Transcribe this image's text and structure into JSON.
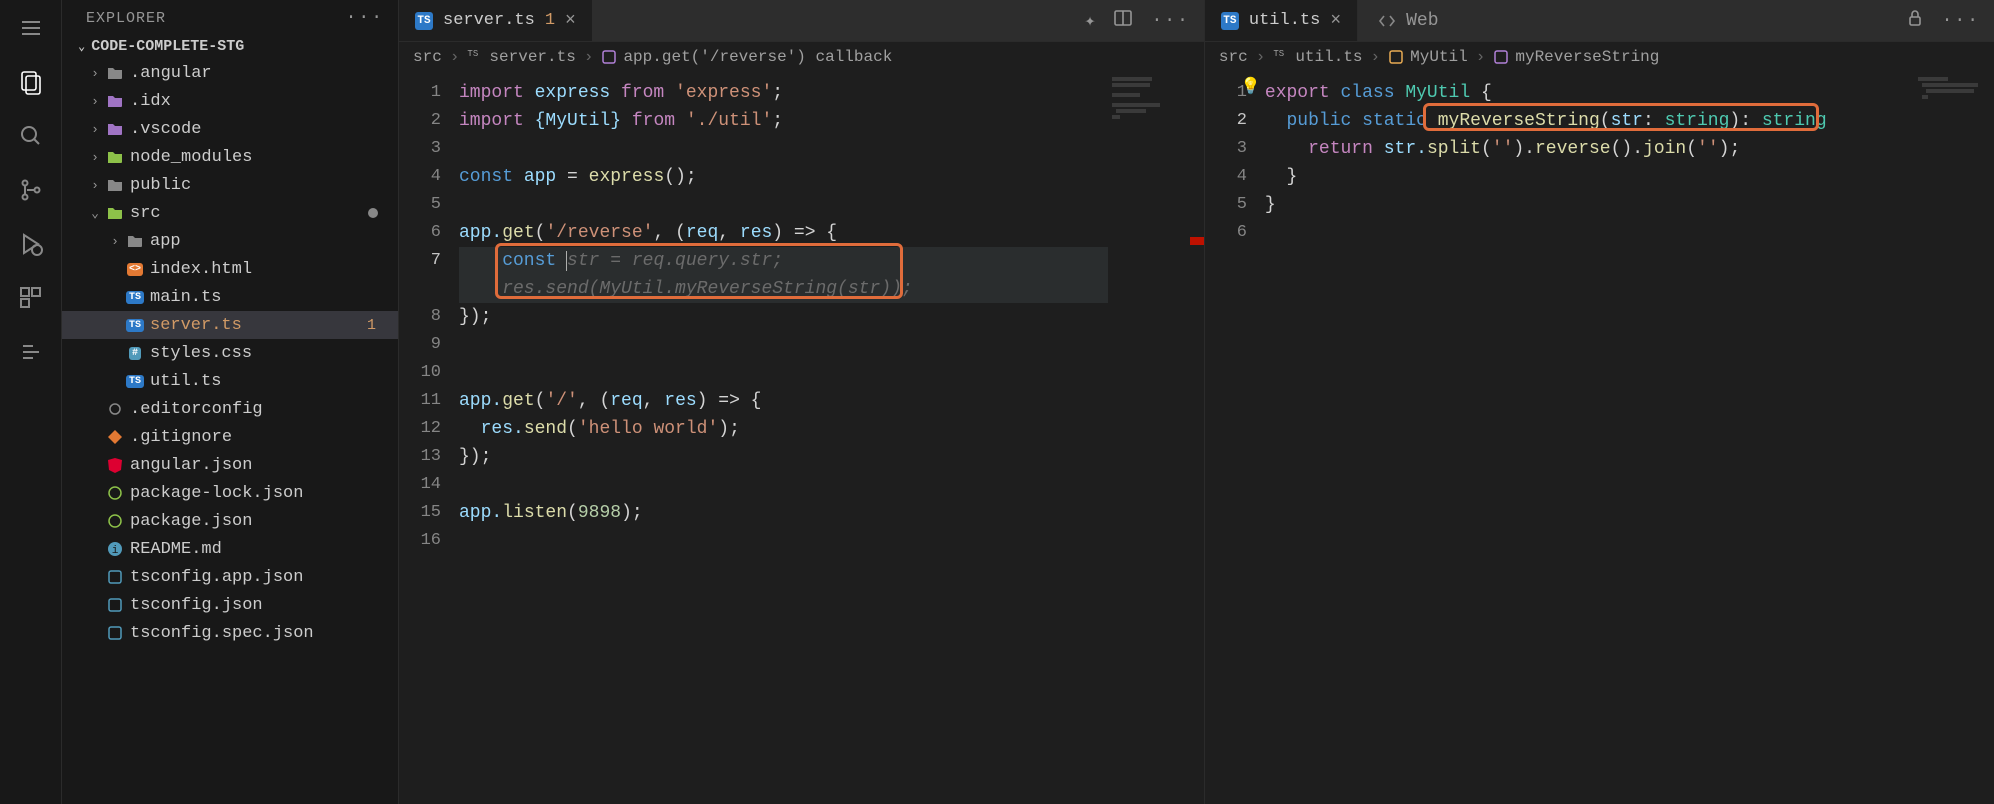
{
  "explorer": {
    "title": "EXPLORER",
    "rootFolder": "CODE-COMPLETE-STG",
    "tree": [
      {
        "label": ".angular",
        "depth": 0,
        "expandable": true,
        "open": false,
        "iconColor": "#888"
      },
      {
        "label": ".idx",
        "depth": 0,
        "expandable": true,
        "open": false,
        "iconColor": "#a074c4"
      },
      {
        "label": ".vscode",
        "depth": 0,
        "expandable": true,
        "open": false,
        "iconColor": "#a074c4"
      },
      {
        "label": "node_modules",
        "depth": 0,
        "expandable": true,
        "open": false,
        "iconColor": "#8dc149"
      },
      {
        "label": "public",
        "depth": 0,
        "expandable": true,
        "open": false,
        "iconColor": "#888"
      },
      {
        "label": "src",
        "depth": 0,
        "expandable": true,
        "open": true,
        "iconColor": "#8dc149",
        "dot": true
      },
      {
        "label": "app",
        "depth": 1,
        "expandable": true,
        "open": false,
        "iconColor": "#888"
      },
      {
        "label": "index.html",
        "depth": 1,
        "expandable": false,
        "icon": "html",
        "iconColor": "#e37933"
      },
      {
        "label": "main.ts",
        "depth": 1,
        "expandable": false,
        "icon": "ts",
        "iconColor": "#519aba"
      },
      {
        "label": "server.ts",
        "depth": 1,
        "expandable": false,
        "icon": "ts",
        "iconColor": "#519aba",
        "active": true,
        "badge": "1",
        "badgeColor": "#d19a66"
      },
      {
        "label": "styles.css",
        "depth": 1,
        "expandable": false,
        "icon": "css",
        "iconColor": "#519aba"
      },
      {
        "label": "util.ts",
        "depth": 1,
        "expandable": false,
        "icon": "ts",
        "iconColor": "#519aba"
      },
      {
        "label": ".editorconfig",
        "depth": 0,
        "expandable": false,
        "icon": "config",
        "iconColor": "#888"
      },
      {
        "label": ".gitignore",
        "depth": 0,
        "expandable": false,
        "icon": "git",
        "iconColor": "#e37933"
      },
      {
        "label": "angular.json",
        "depth": 0,
        "expandable": false,
        "icon": "angular",
        "iconColor": "#dd0031"
      },
      {
        "label": "package-lock.json",
        "depth": 0,
        "expandable": false,
        "icon": "npm",
        "iconColor": "#8dc149"
      },
      {
        "label": "package.json",
        "depth": 0,
        "expandable": false,
        "icon": "npm",
        "iconColor": "#8dc149"
      },
      {
        "label": "README.md",
        "depth": 0,
        "expandable": false,
        "icon": "info",
        "iconColor": "#519aba"
      },
      {
        "label": "tsconfig.app.json",
        "depth": 0,
        "expandable": false,
        "icon": "tsconfig",
        "iconColor": "#519aba"
      },
      {
        "label": "tsconfig.json",
        "depth": 0,
        "expandable": false,
        "icon": "tsconfig",
        "iconColor": "#519aba"
      },
      {
        "label": "tsconfig.spec.json",
        "depth": 0,
        "expandable": false,
        "icon": "tsconfig",
        "iconColor": "#519aba"
      }
    ]
  },
  "editorLeft": {
    "tab": {
      "name": "server.ts",
      "modified": "1"
    },
    "breadcrumbs": [
      "src",
      "server.ts",
      "app.get('/reverse') callback"
    ],
    "lines": 16,
    "activeLine": 7,
    "code": {
      "l1": {
        "a": "import",
        "b": " express ",
        "c": "from",
        "d": " 'express'",
        "e": ";"
      },
      "l2": {
        "a": "import",
        "b": " {MyUtil} ",
        "c": "from",
        "d": " './util'",
        "e": ";"
      },
      "l4": {
        "a": "const",
        "b": " app ",
        "c": "= ",
        "d": "express",
        "e": "();"
      },
      "l6": {
        "a": "app.",
        "b": "get",
        "c": "(",
        "d": "'/reverse'",
        "e": ", (",
        "f": "req",
        "g": ", ",
        "h": "res",
        "i": ") => {"
      },
      "l7": {
        "a": "    const ",
        "ghost": "str = req.query.str;"
      },
      "l7b": {
        "ghost": "    res.send(MyUtil.myReverseString(str));"
      },
      "l8": "});",
      "l11": {
        "a": "app.",
        "b": "get",
        "c": "(",
        "d": "'/'",
        "e": ", (",
        "f": "req",
        "g": ", ",
        "h": "res",
        "i": ") => {"
      },
      "l12": {
        "a": "  res.",
        "b": "send",
        "c": "(",
        "d": "'hello world'",
        "e": ");"
      },
      "l13": "});",
      "l15": {
        "a": "app.",
        "b": "listen",
        "c": "(",
        "d": "9898",
        "e": ");"
      }
    }
  },
  "editorRight": {
    "tab": {
      "name": "util.ts"
    },
    "auxTab": {
      "name": "Web"
    },
    "breadcrumbs": [
      "src",
      "util.ts",
      "MyUtil",
      "myReverseString"
    ],
    "lines": 6,
    "activeLine": 2,
    "code": {
      "l1": {
        "a": "export",
        "b": " class",
        "c": " MyUtil ",
        "d": "{"
      },
      "l2": {
        "a": "  public",
        "b": " static ",
        "c": "myReverseString",
        "d": "(",
        "e": "str",
        "f": ": ",
        "g": "string",
        "h": "): ",
        "i": "string"
      },
      "l3": {
        "a": "    return",
        "b": " str.",
        "c": "split",
        "d": "(",
        "e": "''",
        "f": ").",
        "g": "reverse",
        "h": "().",
        "i": "join",
        "j": "(",
        "k": "''",
        "l": ");"
      },
      "l4": "  }",
      "l5": "}"
    }
  }
}
